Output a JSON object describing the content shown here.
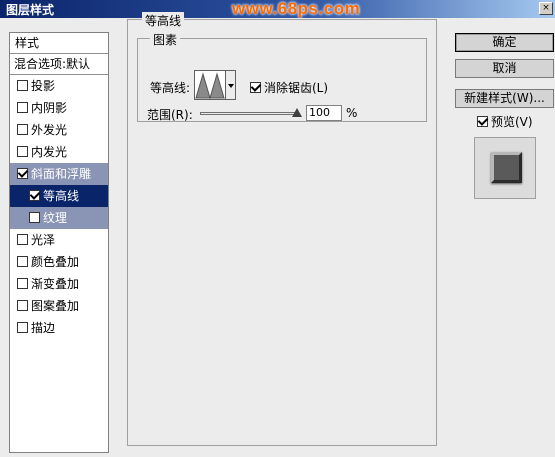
{
  "window": {
    "title": "图层样式",
    "watermark": "www.68ps.com",
    "close_label": "×"
  },
  "styles_panel": {
    "header": "样式",
    "blend_options": "混合选项:默认",
    "items": [
      {
        "label": "投影",
        "checked": false
      },
      {
        "label": "内阴影",
        "checked": false
      },
      {
        "label": "外发光",
        "checked": false
      },
      {
        "label": "内发光",
        "checked": false
      },
      {
        "label": "斜面和浮雕",
        "checked": true
      },
      {
        "label": "等高线",
        "checked": true
      },
      {
        "label": "纹理",
        "checked": false
      },
      {
        "label": "光泽",
        "checked": false
      },
      {
        "label": "颜色叠加",
        "checked": false
      },
      {
        "label": "渐变叠加",
        "checked": false
      },
      {
        "label": "图案叠加",
        "checked": false
      },
      {
        "label": "描边",
        "checked": false
      }
    ]
  },
  "contour_panel": {
    "group_title": "等高线",
    "subgroup_title": "图素",
    "contour_label": "等高线:",
    "anti_alias_label": "消除锯齿(L)",
    "anti_alias_checked": true,
    "range_label": "范围(R):",
    "range_value": "100",
    "range_unit": "%"
  },
  "buttons": {
    "ok": "确定",
    "cancel": "取消",
    "new_style": "新建样式(W)...",
    "preview_label": "预览(V)",
    "preview_checked": true
  }
}
